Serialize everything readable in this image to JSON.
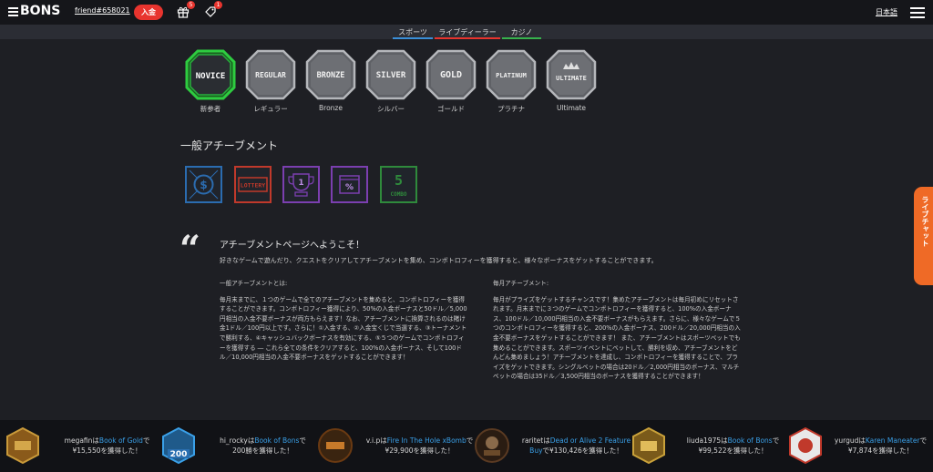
{
  "header": {
    "logo_text": "BONS",
    "user_link": "friend#658021",
    "deposit_label": "入金",
    "gift_badge": "5",
    "promo_badge": "1",
    "language": "日本語"
  },
  "categories": [
    {
      "label": "スポーツ",
      "color": "#3a8fd8"
    },
    {
      "label": "ライブディーラー",
      "color": "#e8342e"
    },
    {
      "label": "カジノ",
      "color": "#37b24d"
    }
  ],
  "ranks": [
    {
      "badge_text": "NOVICE",
      "label": "新参者",
      "active": true
    },
    {
      "badge_text": "REGULAR",
      "label": "レギュラー",
      "active": false
    },
    {
      "badge_text": "BRONZE",
      "label": "Bronze",
      "active": false
    },
    {
      "badge_text": "SILVER",
      "label": "シルバー",
      "active": false
    },
    {
      "badge_text": "GOLD",
      "label": "ゴールド",
      "active": false
    },
    {
      "badge_text": "PLATINUM",
      "label": "プラチナ",
      "active": false
    },
    {
      "badge_text": "ULTIMATE",
      "label": "Ultimate",
      "active": false
    }
  ],
  "achievements_title": "一般アチーブメント",
  "achievements": [
    {
      "icon": "coin-icon",
      "color": "#2b6cb0"
    },
    {
      "icon": "lottery-icon",
      "color": "#c0392b",
      "text": "LOTTERY"
    },
    {
      "icon": "trophy-icon",
      "color": "#7b3fb0",
      "text": "1"
    },
    {
      "icon": "discount-icon",
      "color": "#7b3fb0",
      "text": "%"
    },
    {
      "icon": "combo-icon",
      "color": "#2f8a3c",
      "text": "5",
      "sub": "COMBO"
    }
  ],
  "welcome": {
    "quote_mark": "“",
    "title": "アチーブメントページへようこそ！",
    "intro": "好きなゲームで遊んだり、クエストをクリアしてアチーブメントを集め、コンボトロフィーを獲得すると、様々なボーナスをゲットすることができます。"
  },
  "columns": [
    {
      "heading": "一般アチーブメントとは:",
      "body": "毎月末までに、１つのゲームで全てのアチーブメントを集めると、コンボトロフィーを獲得することができます。コンボトロフィー獲得により、50%の入金ボーナスと50ドル／5,000円相当の入金不要ボーナスが両方もらえます！なお、アチーブメントに換算されるのは賭け金1ドル／100円以上です。さらに！①入金する、②入金宝くじで当選する、③トーナメントで勝利する、④キャッシュバックボーナスを有効にする、⑤５つのゲームでコンボトロフィーを獲得する ― これら全ての条件をクリアすると、100%の入金ボーナス、そして100ドル／10,000円相当の入金不要ボーナスをゲットすることができます！"
    },
    {
      "heading": "毎月アチーブメント:",
      "body": "毎月がプライズをゲットするチャンスです！集めたアチーブメントは毎月初めにリセットされます。月末までに３つのゲームでコンボトロフィーを獲得すると、100%の入金ボーナス、100ドル／10,000円相当の入金不要ボーナスがもらえます。さらに、様々なゲームで５つのコンボトロフィーを獲得すると、200%の入金ボーナス、200ドル／20,000円相当の入金不要ボーナスをゲットすることができます！ また、アチーブメントはスポーツベットでも集めることができます。スポーツイベントにベットして、勝利を収め、アチーブメントをどんどん集めましょう！アチーブメントを達成し、コンボトロフィーを獲得することで、プライズをゲットできます。シングルベットの場合は20ドル／2,000円相当のボーナス、マルチベットの場合は35ドル／3,500円相当のボーナスを獲得することができます！"
    }
  ],
  "live_chat": "ライブチャット",
  "winners": [
    {
      "user": "megafin",
      "game": "Book of Gold",
      "amount": "¥15,550を獲得した！",
      "thumb_color": "#8a5a1a"
    },
    {
      "user": "hi_rocky",
      "game": "Book of Bons",
      "amount": "200勝を獲得した！",
      "thumb_color": "#2a6fb0",
      "thumb_text": "200"
    },
    {
      "user": "v.i.p",
      "game": "Fire In The Hole xBomb",
      "amount": "¥29,900を獲得した！",
      "thumb_color": "#6b3a12"
    },
    {
      "user": "raritet",
      "game": "Dead or Alive 2 Feature Buy",
      "amount": "¥130,426を獲得した！",
      "thumb_color": "#5a3a22"
    },
    {
      "user": "liuda1975",
      "game": "Book of Bons",
      "amount": "¥99,522を獲得した！",
      "thumb_color": "#c9a13a"
    },
    {
      "user": "yurgud",
      "game": "Karen Maneater",
      "amount": "¥7,874を獲得した！",
      "thumb_color": "#c0392b"
    }
  ]
}
